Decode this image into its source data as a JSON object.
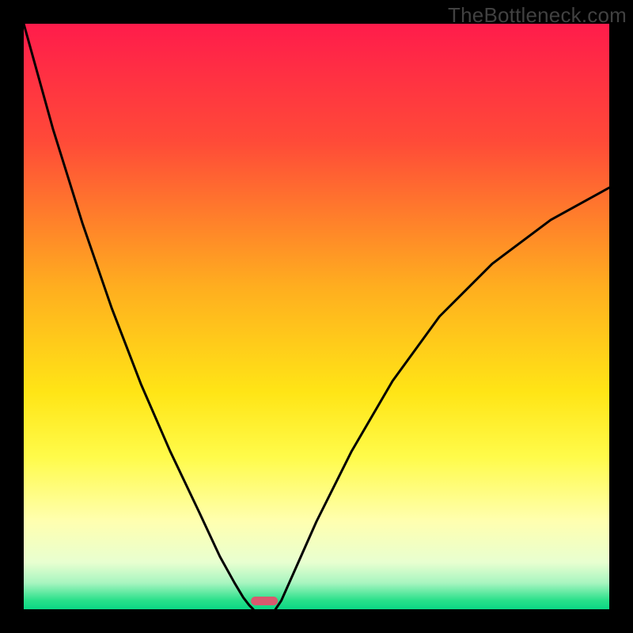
{
  "watermark": "TheBottleneck.com",
  "chart_data": {
    "type": "line",
    "title": "",
    "xlabel": "",
    "ylabel": "",
    "xlim": [
      0,
      1
    ],
    "ylim": [
      0,
      1
    ],
    "gradient_stops": [
      {
        "offset": 0.0,
        "color": "#ff1c4b"
      },
      {
        "offset": 0.2,
        "color": "#ff4a38"
      },
      {
        "offset": 0.45,
        "color": "#ffae1f"
      },
      {
        "offset": 0.63,
        "color": "#ffe516"
      },
      {
        "offset": 0.74,
        "color": "#fffb4a"
      },
      {
        "offset": 0.85,
        "color": "#ffffb0"
      },
      {
        "offset": 0.92,
        "color": "#e8ffd0"
      },
      {
        "offset": 0.955,
        "color": "#a8f5c0"
      },
      {
        "offset": 0.985,
        "color": "#28e08a"
      },
      {
        "offset": 1.0,
        "color": "#0ad684"
      }
    ],
    "series": [
      {
        "name": "left-curve",
        "x": [
          0.0,
          0.05,
          0.1,
          0.15,
          0.2,
          0.25,
          0.3,
          0.335,
          0.36,
          0.375,
          0.385,
          0.392
        ],
        "y": [
          1.0,
          0.82,
          0.66,
          0.515,
          0.385,
          0.27,
          0.165,
          0.09,
          0.045,
          0.02,
          0.007,
          0.0
        ]
      },
      {
        "name": "right-curve",
        "x": [
          0.43,
          0.44,
          0.46,
          0.5,
          0.56,
          0.63,
          0.71,
          0.8,
          0.9,
          1.0
        ],
        "y": [
          0.0,
          0.015,
          0.06,
          0.15,
          0.27,
          0.39,
          0.5,
          0.59,
          0.665,
          0.72
        ]
      }
    ],
    "marker": {
      "x_center": 0.411,
      "half_width": 0.023,
      "color": "#d85a6e"
    }
  }
}
